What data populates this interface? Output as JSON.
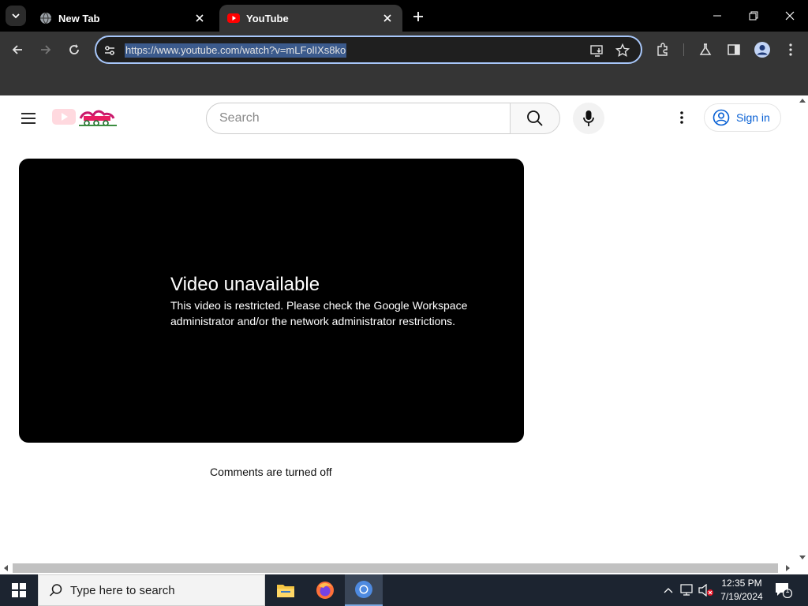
{
  "browser": {
    "tabs": [
      {
        "title": "New Tab",
        "active": false
      },
      {
        "title": "YouTube",
        "active": true
      }
    ],
    "address_url": "https://www.youtube.com/watch?v=mLFolIXs8ko"
  },
  "youtube": {
    "search_placeholder": "Search",
    "sign_in_label": "Sign in",
    "player": {
      "error_title": "Video unavailable",
      "error_message": "This video is restricted. Please check the Google Workspace administrator and/or the network administrator restrictions."
    },
    "comments_status": "Comments are turned off"
  },
  "taskbar": {
    "search_placeholder": "Type here to search",
    "clock": {
      "time": "12:35 PM",
      "date": "7/19/2024"
    },
    "notification_count": "1"
  },
  "colors": {
    "accent_blue": "#065fd4",
    "omnibox_focus": "#a8c7fa",
    "youtube_red": "#ff0000"
  }
}
